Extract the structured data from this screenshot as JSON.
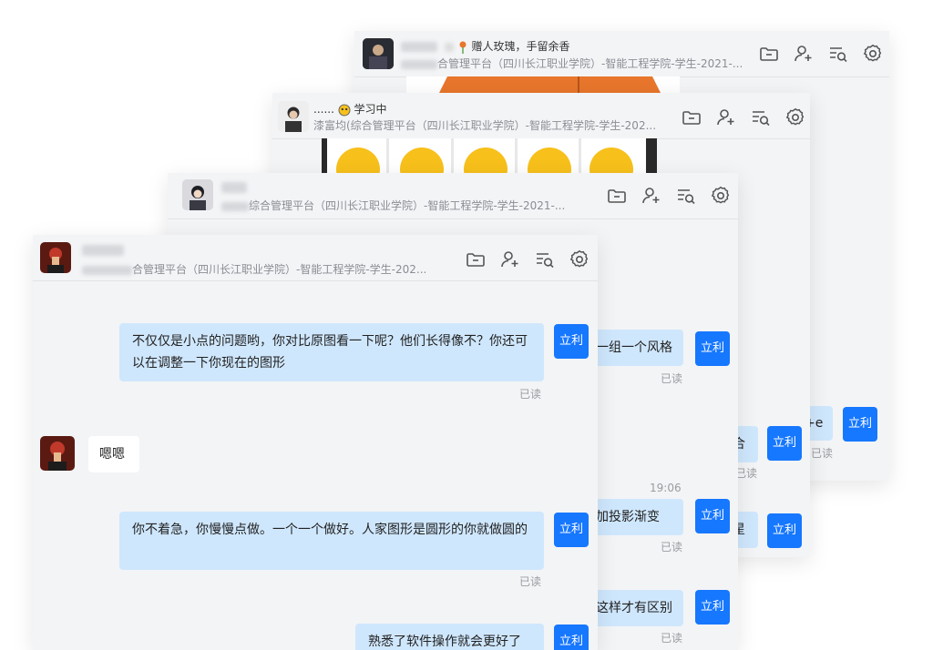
{
  "w1": {
    "status_text": "赠人玫瑰，手留余香",
    "subtitle_visible": "合管理平台（四川长江职业学院）-智能工程学院-学生-2021-...",
    "partial_bubble_1": "+e",
    "sender_tag": "立利",
    "read_label": "已读"
  },
  "w2": {
    "name_prefix": "......",
    "status_text": "学习中",
    "subtitle": "漆富均(综合管理平台（四川长江职业学院）-智能工程学院-学生-202...",
    "partial_bubble_1": "合",
    "partial_bubble_2": "星",
    "sender_tag": "立利",
    "read_label": "已读"
  },
  "w3": {
    "subtitle_visible": "综合管理平台（四川长江职业学院）-智能工程学院-学生-2021-...",
    "partial_bubble_1": "一组一个风格",
    "partial_bubble_2": "加投影渐变",
    "partial_bubble_3": "这样才有区别",
    "time": "19:06",
    "sender_tag": "立利",
    "read_label": "已读"
  },
  "w4": {
    "subtitle_visible": "合管理平台（四川长江职业学院）-智能工程学院-学生-202...",
    "messages": [
      {
        "text": "不仅仅是小点的问题哟，你对比原图看一下呢？他们长得像不？你还可以在调整一下你现在的图形"
      },
      {
        "text": "嗯嗯"
      },
      {
        "text": "你不着急，你慢慢点做。一个一个做好。人家图形是圆形的你就做圆的"
      },
      {
        "text": "熟悉了软件操作就会更好了"
      }
    ],
    "sender_tag": "立利",
    "read_label": "已读"
  },
  "colors": {
    "accent": "#1677ff",
    "bubble_out": "#cfe7fd",
    "window_bg": "#f3f4f6",
    "thumb_orange": "#e8762c",
    "thumb_yellow": "#f7c01b"
  },
  "icons": [
    "folder-icon",
    "add-user-icon",
    "search-list-icon",
    "gear-icon",
    "rose-icon",
    "emoji-status-icon"
  ]
}
